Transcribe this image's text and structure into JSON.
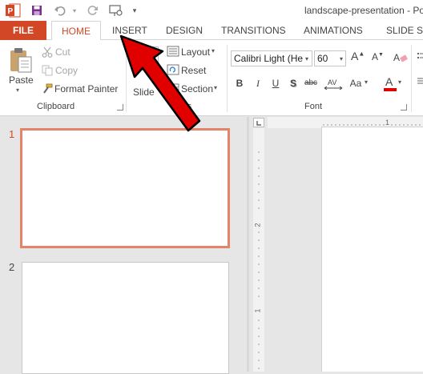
{
  "window": {
    "title": "landscape-presentation - Pow"
  },
  "quick_access": {
    "icons": [
      "powerpoint-logo-icon",
      "save-icon",
      "undo-icon",
      "redo-icon",
      "presentation-icon",
      "customize-icon"
    ]
  },
  "tabs": [
    {
      "label": "FILE"
    },
    {
      "label": "HOME",
      "active": true
    },
    {
      "label": "INSERT"
    },
    {
      "label": "DESIGN"
    },
    {
      "label": "TRANSITIONS"
    },
    {
      "label": "ANIMATIONS"
    },
    {
      "label": "SLIDE SH"
    }
  ],
  "clipboard": {
    "paste_label": "Paste",
    "cut_label": "Cut",
    "copy_label": "Copy",
    "format_painter_label": "Format Painter",
    "group_label": "Clipboard"
  },
  "slides": {
    "new_slide_label": "Slide",
    "layout_label": "Layout",
    "reset_label": "Reset",
    "section_label": "Section",
    "group_label": "ides"
  },
  "font": {
    "name": "Calibri Light (He",
    "size": "60",
    "group_label": "Font",
    "bold": "B",
    "italic": "I",
    "underline": "U",
    "shadow": "S",
    "strikethrough": "abc",
    "case": "Aa"
  },
  "thumbnails": [
    {
      "number": "1",
      "selected": true
    },
    {
      "number": "2",
      "selected": false
    }
  ],
  "rulers": {
    "h_tick": "1",
    "v_tick_1": "2",
    "v_tick_2": "1"
  },
  "colors": {
    "accent": "#d24726",
    "selection_border": "#e38468",
    "arrow": "#e00000"
  }
}
